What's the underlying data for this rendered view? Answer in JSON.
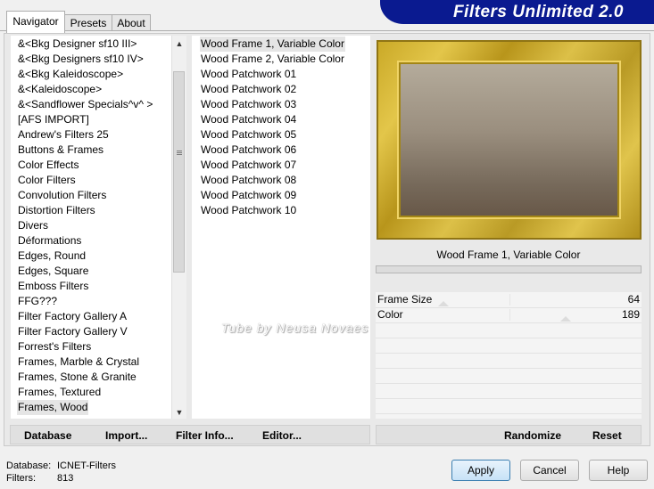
{
  "tabs": [
    {
      "label": "Navigator"
    },
    {
      "label": "Presets"
    },
    {
      "label": "About"
    }
  ],
  "banner": "Filters Unlimited 2.0",
  "categories": [
    {
      "label": "&<Bkg Designer sf10 III>"
    },
    {
      "label": "&<Bkg Designers sf10 IV>"
    },
    {
      "label": "&<Bkg Kaleidoscope>"
    },
    {
      "label": "&<Kaleidoscope>"
    },
    {
      "label": "&<Sandflower Specials^v^ >"
    },
    {
      "label": "[AFS IMPORT]"
    },
    {
      "label": "Andrew's Filters 25"
    },
    {
      "label": "Buttons & Frames"
    },
    {
      "label": "Color Effects"
    },
    {
      "label": "Color Filters"
    },
    {
      "label": "Convolution Filters"
    },
    {
      "label": "Distortion Filters"
    },
    {
      "label": "Divers"
    },
    {
      "label": "Déformations"
    },
    {
      "label": "Edges, Round"
    },
    {
      "label": "Edges, Square"
    },
    {
      "label": "Emboss Filters"
    },
    {
      "label": "FFG???"
    },
    {
      "label": "Filter Factory Gallery A"
    },
    {
      "label": "Filter Factory Gallery V"
    },
    {
      "label": "Forrest's Filters"
    },
    {
      "label": "Frames, Marble & Crystal"
    },
    {
      "label": "Frames, Stone & Granite"
    },
    {
      "label": "Frames, Textured"
    },
    {
      "label": "Frames, Wood"
    }
  ],
  "selected_category": "Frames, Wood",
  "filters": [
    {
      "label": "Wood Frame 1, Variable Color"
    },
    {
      "label": "Wood Frame 2, Variable Color"
    },
    {
      "label": "Wood Patchwork 01"
    },
    {
      "label": "Wood Patchwork 02"
    },
    {
      "label": "Wood Patchwork 03"
    },
    {
      "label": "Wood Patchwork 04"
    },
    {
      "label": "Wood Patchwork 05"
    },
    {
      "label": "Wood Patchwork 06"
    },
    {
      "label": "Wood Patchwork 07"
    },
    {
      "label": "Wood Patchwork 08"
    },
    {
      "label": "Wood Patchwork 09"
    },
    {
      "label": "Wood Patchwork 10"
    }
  ],
  "selected_filter": "Wood Frame 1, Variable Color",
  "params": [
    {
      "label": "Frame Size",
      "value": "64",
      "level": 0.25
    },
    {
      "label": "Color",
      "value": "189",
      "level": 0.74
    }
  ],
  "toolbar_left": {
    "database": "Database",
    "import": "Import...",
    "filter_info": "Filter Info...",
    "editor": "Editor..."
  },
  "toolbar_right": {
    "randomize": "Randomize",
    "reset": "Reset"
  },
  "watermark": "Tube by Neusa Novaes",
  "status": {
    "database_label": "Database:",
    "database_value": "ICNET-Filters",
    "filters_label": "Filters:",
    "filters_value": "813"
  },
  "buttons": {
    "apply": "Apply",
    "cancel": "Cancel",
    "help": "Help"
  },
  "colors": {
    "banner_bg": "#0a1a90",
    "frame_gold": "#c9a826",
    "apply_accent": "#3c7fb1"
  }
}
